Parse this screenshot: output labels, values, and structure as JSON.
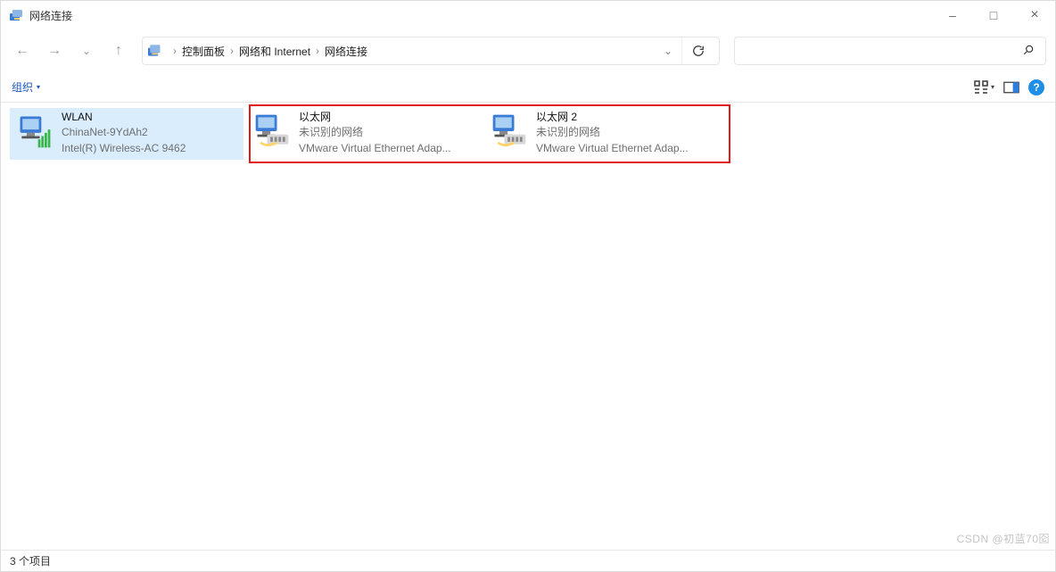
{
  "window": {
    "title": "网络连接",
    "minimize": "–",
    "maximize": "□",
    "close": "×"
  },
  "breadcrumbs": {
    "items": [
      "控制面板",
      "网络和 Internet",
      "网络连接"
    ]
  },
  "toolbar": {
    "organize": "组织",
    "help_tooltip": "?"
  },
  "connections": [
    {
      "name": "WLAN",
      "status": "ChinaNet-9YdAh2",
      "desc": "Intel(R) Wireless-AC 9462",
      "selected": true
    },
    {
      "name": "以太网",
      "status": "未识别的网络",
      "desc": "VMware Virtual Ethernet Adap...",
      "selected": false
    },
    {
      "name": "以太网 2",
      "status": "未识别的网络",
      "desc": "VMware Virtual Ethernet Adap...",
      "selected": false
    }
  ],
  "status": {
    "item_count": "3 个项目"
  },
  "watermark": "CSDN @初蓝70囵"
}
